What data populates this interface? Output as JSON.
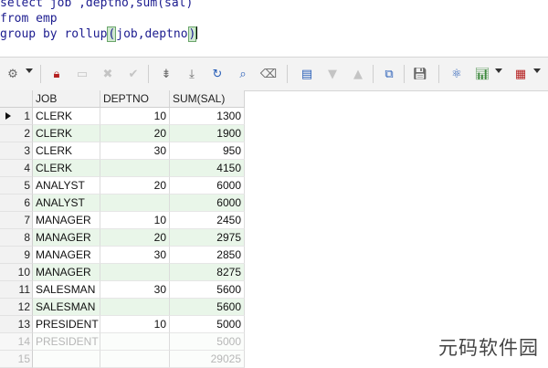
{
  "editor": {
    "lines": [
      {
        "kw": "select",
        "rest": " job ,deptno,sum(sal)"
      },
      {
        "kw": "from",
        "rest": " emp"
      },
      {
        "kw": "group by",
        "pre": " rollup",
        "hl_open": "(",
        "mid": "job,deptno",
        "hl_close": ")"
      }
    ]
  },
  "toolbar": {
    "icons": [
      "settings-icon",
      "lock-icon",
      "insert-record-icon",
      "delete-record-icon",
      "post-check-icon",
      "filter-icon",
      "filter-all-icon",
      "refresh-icon",
      "find-icon",
      "clear-icon",
      "export-icon",
      "move-down-icon",
      "move-up-icon",
      "link-icon",
      "save-icon",
      "query-icon",
      "chart-icon",
      "columns-icon"
    ]
  },
  "grid": {
    "columns": [
      "JOB",
      "DEPTNO",
      "SUM(SAL)"
    ],
    "rows": [
      {
        "n": "1",
        "job": "CLERK",
        "deptno": "10",
        "sum": "1300"
      },
      {
        "n": "2",
        "job": "CLERK",
        "deptno": "20",
        "sum": "1900"
      },
      {
        "n": "3",
        "job": "CLERK",
        "deptno": "30",
        "sum": "950"
      },
      {
        "n": "4",
        "job": "CLERK",
        "deptno": "",
        "sum": "4150"
      },
      {
        "n": "5",
        "job": "ANALYST",
        "deptno": "20",
        "sum": "6000"
      },
      {
        "n": "6",
        "job": "ANALYST",
        "deptno": "",
        "sum": "6000"
      },
      {
        "n": "7",
        "job": "MANAGER",
        "deptno": "10",
        "sum": "2450"
      },
      {
        "n": "8",
        "job": "MANAGER",
        "deptno": "20",
        "sum": "2975"
      },
      {
        "n": "9",
        "job": "MANAGER",
        "deptno": "30",
        "sum": "2850"
      },
      {
        "n": "10",
        "job": "MANAGER",
        "deptno": "",
        "sum": "8275"
      },
      {
        "n": "11",
        "job": "SALESMAN",
        "deptno": "30",
        "sum": "5600"
      },
      {
        "n": "12",
        "job": "SALESMAN",
        "deptno": "",
        "sum": "5600"
      },
      {
        "n": "13",
        "job": "PRESIDENT",
        "deptno": "10",
        "sum": "5000"
      },
      {
        "n": "14",
        "job": "PRESIDENT",
        "deptno": "",
        "sum": "5000"
      },
      {
        "n": "15",
        "job": "",
        "deptno": "",
        "sum": "29025"
      }
    ]
  },
  "watermark": {
    "text": "元码软件园"
  }
}
